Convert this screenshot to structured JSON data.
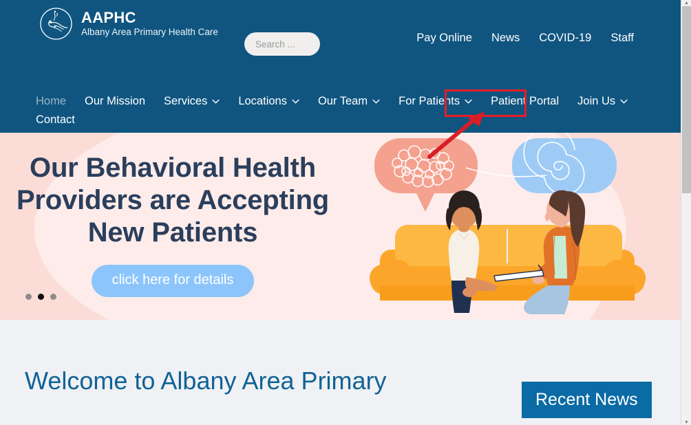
{
  "browser": {
    "scrollbar": {
      "up_icon": "scroll-up-arrow",
      "down_icon": "scroll-down-arrow"
    }
  },
  "header": {
    "bg_color": "#0f5580",
    "brand": {
      "logo_icon": "aaphc-circle-logo",
      "title": "AAPHC",
      "subtitle": "Albany Area Primary Health Care"
    },
    "search": {
      "placeholder": "Search ...",
      "value": ""
    },
    "utility_nav": [
      {
        "label": "Pay Online"
      },
      {
        "label": "News"
      },
      {
        "label": "COVID-19"
      },
      {
        "label": "Staff"
      }
    ],
    "main_nav": [
      {
        "label": "Home",
        "has_dropdown": false,
        "current": true
      },
      {
        "label": "Our Mission",
        "has_dropdown": false,
        "current": false
      },
      {
        "label": "Services",
        "has_dropdown": true,
        "current": false
      },
      {
        "label": "Locations",
        "has_dropdown": true,
        "current": false
      },
      {
        "label": "Our Team",
        "has_dropdown": true,
        "current": false
      },
      {
        "label": "For Patients",
        "has_dropdown": true,
        "current": false
      },
      {
        "label": "Patient Portal",
        "has_dropdown": false,
        "current": false,
        "highlighted": true
      },
      {
        "label": "Join Us",
        "has_dropdown": true,
        "current": false
      },
      {
        "label": "Contact",
        "has_dropdown": false,
        "current": false
      }
    ]
  },
  "annotation": {
    "target_label": "Patient Portal",
    "box_color": "#ec1c24",
    "arrow_color": "#d81e26"
  },
  "hero": {
    "bg_color": "#fcdcd7",
    "title_line1": "Our Behavioral Health",
    "title_line2": "Providers are Accepting",
    "title_line3": "New Patients",
    "title_color": "#2b3e5c",
    "cta_label": "click here for details",
    "cta_color": "#8cc5fb",
    "slider": {
      "total_dots": 3,
      "active_index": 1
    },
    "illustration": {
      "name": "therapy-session-illustration",
      "bubble_left_color": "#f4a18f",
      "bubble_right_color": "#9ecbf5",
      "couch_color": "#fba62a"
    }
  },
  "content": {
    "bg_color": "#eff1f5",
    "welcome_heading": "Welcome to Albany Area Primary",
    "welcome_color": "#106294",
    "recent_news": {
      "label": "Recent News",
      "bg_color": "#0a6ba5"
    }
  }
}
